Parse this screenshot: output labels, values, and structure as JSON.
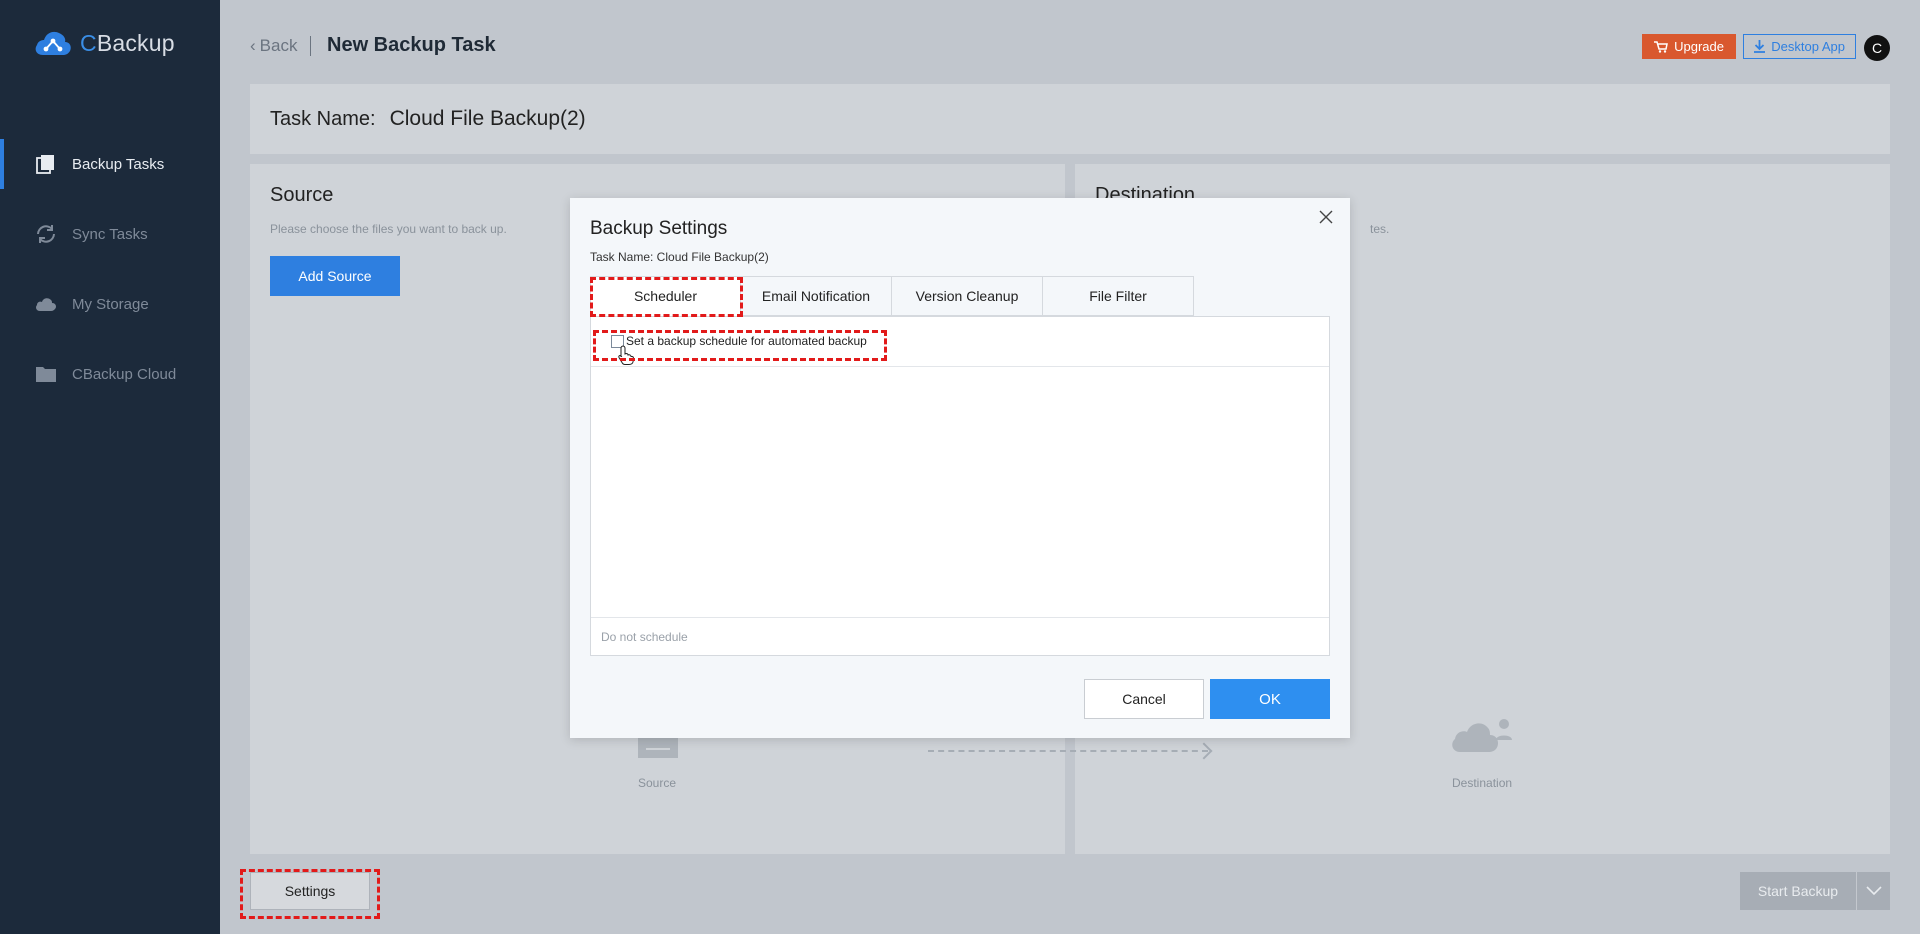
{
  "brand": {
    "logo_c": "C",
    "logo_rest": "Backup"
  },
  "sidebar": {
    "items": [
      {
        "label": "Backup Tasks",
        "icon": "backup-tasks-icon",
        "active": true
      },
      {
        "label": "Sync Tasks",
        "icon": "sync-icon",
        "active": false
      },
      {
        "label": "My Storage",
        "icon": "cloud-icon",
        "active": false
      },
      {
        "label": "CBackup Cloud",
        "icon": "folder-icon",
        "active": false
      }
    ]
  },
  "header": {
    "back_label": "Back",
    "title": "New Backup Task",
    "upgrade_label": "Upgrade",
    "desktop_app_label": "Desktop App",
    "avatar_initial": "C"
  },
  "task": {
    "label": "Task Name:",
    "value": "Cloud File Backup(2)"
  },
  "source_panel": {
    "title": "Source",
    "description": "Please choose the files you want to back up.",
    "add_source_label": "Add Source",
    "diagram_label": "Source"
  },
  "destination_panel": {
    "title": "Destination",
    "description_visible": "tes.",
    "diagram_label": "Destination"
  },
  "footer": {
    "settings_label": "Settings",
    "start_backup_label": "Start Backup"
  },
  "modal": {
    "title": "Backup Settings",
    "subtitle": "Task Name: Cloud File Backup(2)",
    "tabs": [
      "Scheduler",
      "Email Notification",
      "Version Cleanup",
      "File Filter"
    ],
    "active_tab": "Scheduler",
    "schedule_checkbox_label": "Set a backup schedule for automated backup",
    "schedule_checked": false,
    "status_text": "Do not schedule",
    "cancel_label": "Cancel",
    "ok_label": "OK"
  },
  "colors": {
    "sidebar_bg": "#1c2a3b",
    "accent": "#2e7fe0",
    "upgrade": "#d9582e",
    "highlight": "#e21a1a"
  }
}
